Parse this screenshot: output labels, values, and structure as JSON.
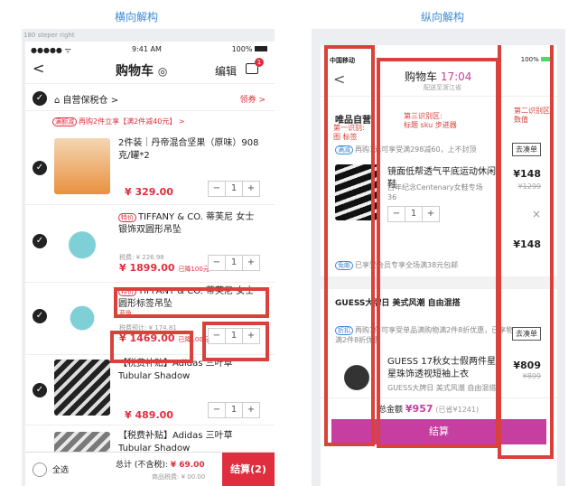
{
  "captions": {
    "left": "横向解构",
    "right": "纵向解构"
  },
  "left": {
    "note": "180 steper right",
    "status": {
      "carrier": "●●●●● ᯤ",
      "time": "9:41 AM",
      "battery": "100%"
    },
    "nav": {
      "back": "<",
      "title": "购物车",
      "edit": "编辑",
      "badge": "1"
    },
    "store": {
      "name": "自营保税仓 >",
      "coupon": "领券 >"
    },
    "promo": {
      "tag": "满额减",
      "text": "再购2件立享【满2件减40元】 >"
    },
    "items": [
      {
        "name": "2件装｜丹帝混合坚果（原味）908克/罐*2",
        "tag": "",
        "price": "¥ 329.00",
        "qty": "1",
        "tax": "",
        "saved": ""
      },
      {
        "name": "TIFFANY & CO. 蒂芙尼 女士 银饰双圆形吊坠",
        "tag": "特价",
        "price": "¥ 1899.00",
        "qty": "1",
        "tax": "税费: ¥ 226.98",
        "saved": "已降100元"
      },
      {
        "name": "TIFFANY & CO. 蒂芙尼 女士圆形标签吊坠",
        "tag": "特价",
        "price": "¥ 1469.00",
        "qty": "1",
        "tax": "税费预计: ¥ 174.81",
        "saved": "已降100元",
        "color": "蓝色"
      },
      {
        "name": "【税费补贴】Adidas 三叶草 Tubular Shadow",
        "tag": "",
        "price": "¥ 489.00",
        "qty": "1",
        "tax": "",
        "saved": ""
      },
      {
        "name": "【税费补贴】Adidas 三叶草 Tubular Shadow",
        "tag": "",
        "price": "",
        "qty": "",
        "tax": "",
        "saved": ""
      }
    ],
    "footer": {
      "select_all": "全选",
      "total_label": "总计 (不含税):",
      "total": "¥ 69.00",
      "tax": "商品税费: ¥ 00.00",
      "checkout": "结算(2)"
    },
    "stepper": {
      "minus": "−",
      "plus": "+"
    }
  },
  "right": {
    "status": {
      "carrier": "中国移动",
      "time": "17:04",
      "battery": "100%"
    },
    "nav": {
      "back": "<",
      "title": "购物车",
      "time": "17:04",
      "sub": "配送至浙江省"
    },
    "store1": "唯品自营",
    "promo": {
      "tag": "满减",
      "text": "再购1元可享受满298减60，上不封顶",
      "btn": "去凑单"
    },
    "annot": {
      "a1": "第一识别:\n图 标签",
      "a2": "第二识别区\n数值",
      "a3": "第三识别区:\n标题 sku 步进器"
    },
    "item1": {
      "name": "镜面低帮透气平底运动休闲鞋",
      "meta": "百年纪念Centenary女鞋专场",
      "size": "36",
      "price": "¥148",
      "old": "¥1299",
      "qty": "1",
      "total": "¥148"
    },
    "freeship": {
      "tag": "免邮",
      "text": "已享受会员专享全场满38元包邮"
    },
    "store2": "GUESS大牌日 美式风潮 自由混搭",
    "promo2": {
      "tag": "折扣",
      "text": "再购1件可享受单品满购物满2件8折优惠，已享物满2件8折优惠",
      "btn": "去凑单"
    },
    "item2": {
      "name": "GUESS 17秋女士假两件星星珠饰透视短袖上衣",
      "meta": "GUESS大牌日 美式风潮 自由混搭",
      "price": "¥809",
      "old": "¥899"
    },
    "footer": {
      "label": "总金额",
      "total": "¥957",
      "saved": "(已省¥1241)",
      "checkout": "结算"
    }
  }
}
